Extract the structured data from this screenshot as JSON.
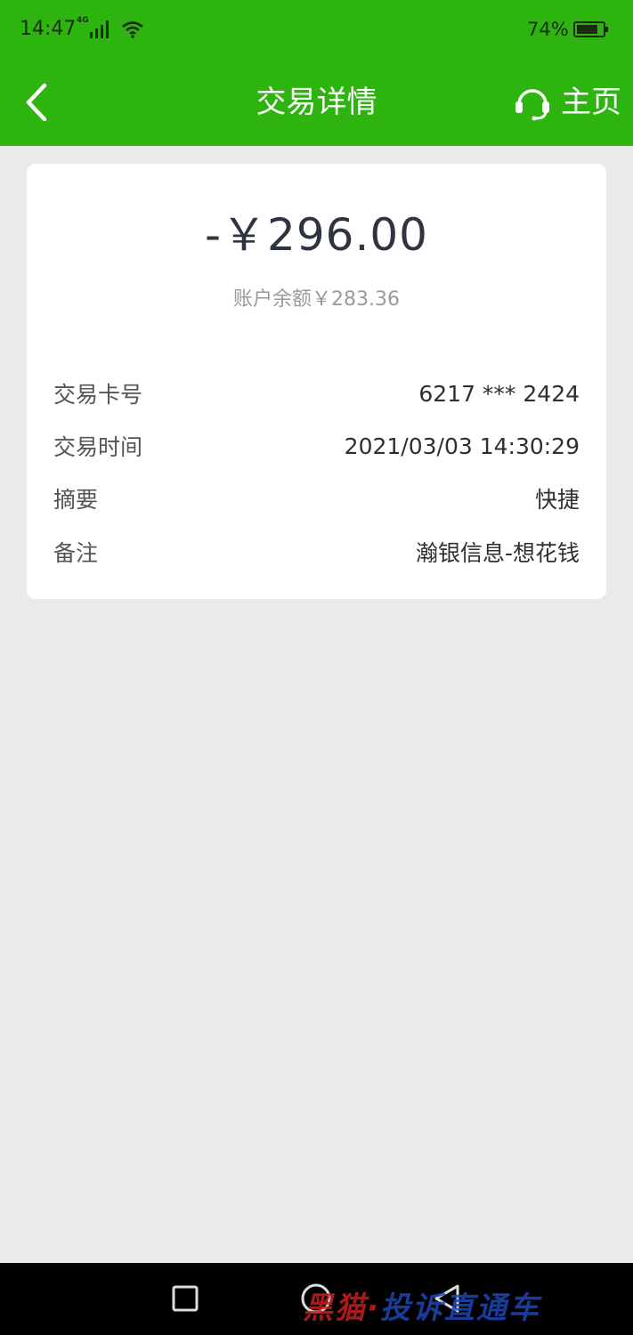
{
  "status_bar": {
    "time": "14:47",
    "network": "4G",
    "battery": "74%"
  },
  "header": {
    "title": "交易详情",
    "home_label": "主页"
  },
  "transaction": {
    "amount": "-￥296.00",
    "balance": "账户余额￥283.36",
    "rows": [
      {
        "label": "交易卡号",
        "value": "6217 *** 2424"
      },
      {
        "label": "交易时间",
        "value": "2021/03/03 14:30:29"
      },
      {
        "label": "摘要",
        "value": "快捷"
      },
      {
        "label": "备注",
        "value": "瀚银信息-想花钱"
      }
    ]
  },
  "watermark": {
    "part1": "黑猫",
    "part2": "投诉直通车"
  },
  "colors": {
    "brand_green": "#2db40f",
    "background": "#e9eaea",
    "card": "#ffffff"
  }
}
